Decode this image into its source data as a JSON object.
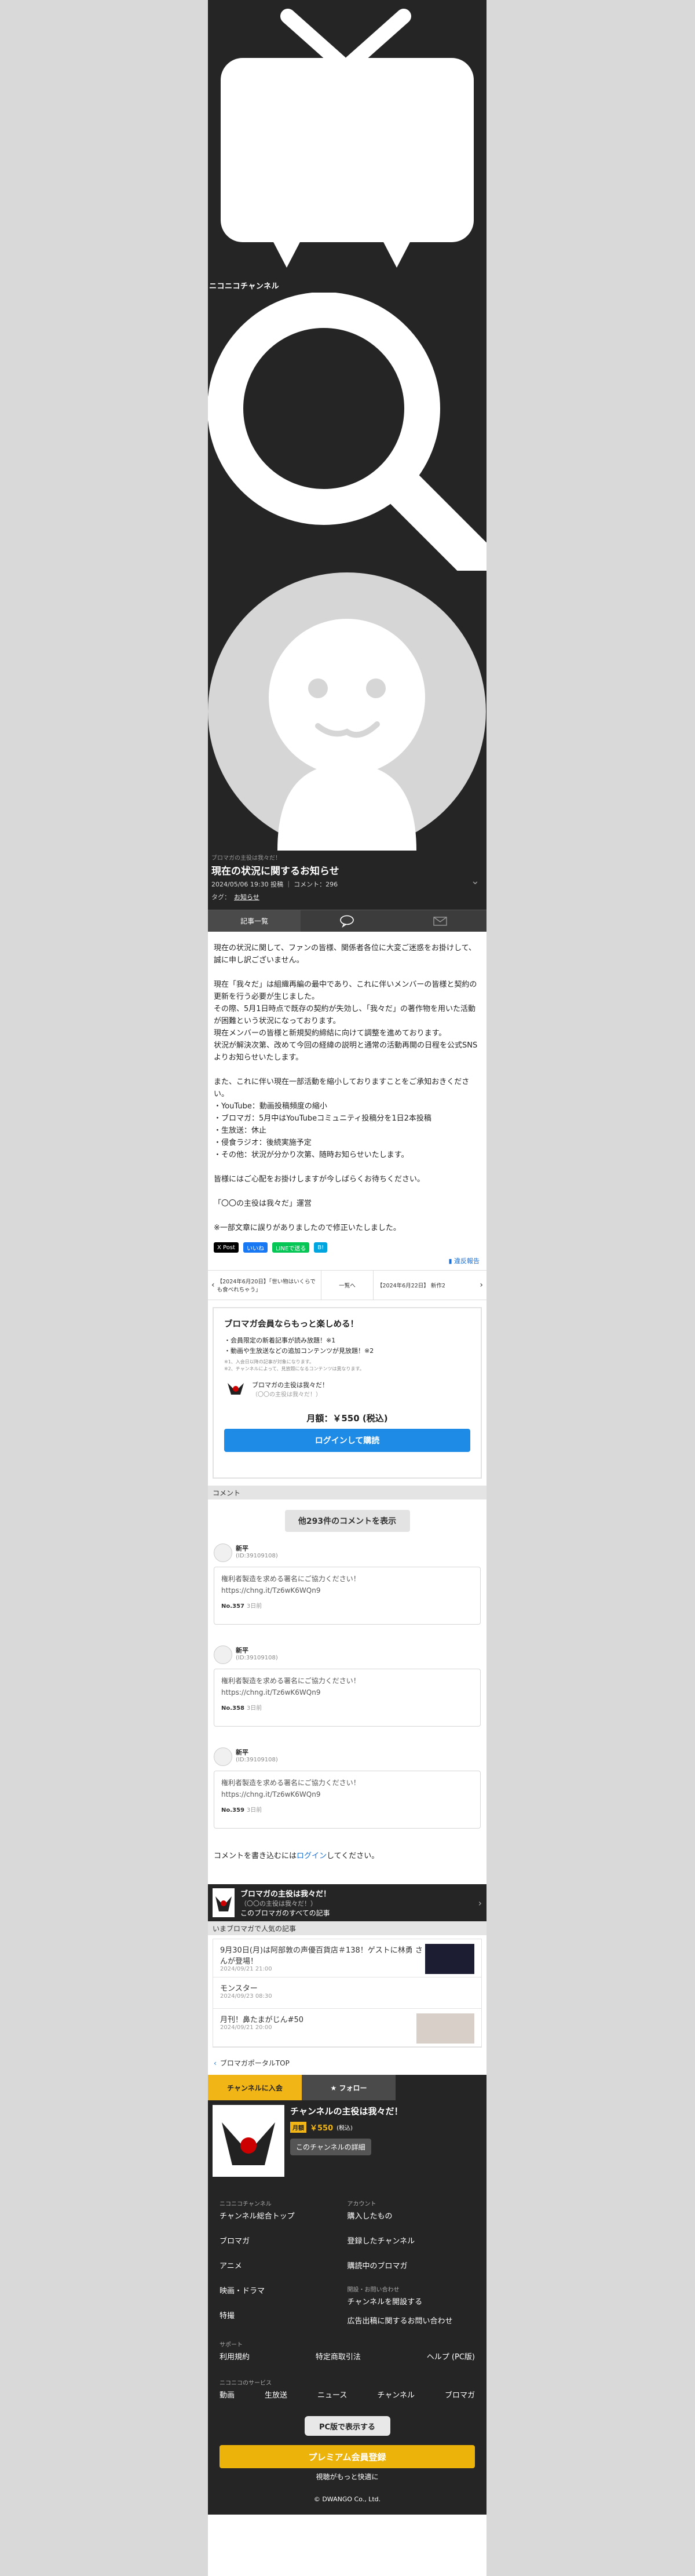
{
  "header": {
    "logo_text": "ニコニコチャンネル"
  },
  "article": {
    "category": "ブロマガの主役は我々だ！",
    "title": "現在の状況に関するお知らせ",
    "meta": "2024/05/06 19:30 投稿 ｜ コメント：296",
    "tag_label": "タグ：",
    "tag": "お知らせ",
    "paragraphs": [
      "現在の状況に関して、ファンの皆様、関係者各位に大変ご迷惑をお掛けして、誠に申し訳ございません。",
      "現在「我々だ」は組織再編の最中であり、これに伴いメンバーの皆様と契約の更新を行う必要が生じました。\nその際、5月1日時点で既存の契約が失効し、「我々だ」の著作物を用いた活動が困難という状況になっております。\n現在メンバーの皆様と新規契約締結に向けて調整を進めております。\n状況が解決次第、改めて今回の経緯の説明と通常の活動再開の日程を公式SNSよりお知らせいたします。",
      "また、これに伴い現在一部活動を縮小しておりますことをご承知おきください。\n・YouTube：動画投稿頻度の縮小\n・ブロマガ：5月中はYouTubeコミュニティ投稿分を1日2本投稿\n・生放送：休止\n・侵食ラジオ：後続実施予定\n・その他：状況が分かり次第、随時お知らせいたします。",
      "皆様にはご心配をお掛けしますが今しばらくお待ちください。",
      "「〇〇の主役は我々だ」運営",
      "※一部文章に誤りがありましたので修正いたしました。"
    ]
  },
  "tabs": [
    "記事一覧",
    "",
    ""
  ],
  "share": {
    "x": "X Post",
    "fb": "いいね",
    "line": "LINEで送る",
    "hatena": "B!"
  },
  "report": "違反報告",
  "nav": {
    "prev": "【2024年6月20日】「世い物はいくらでも食べれちゃう」",
    "list": "一覧へ",
    "next": "【2024年6月22日】 新作2"
  },
  "membership": {
    "title": "ブロマガ会員ならもっと楽しめる！",
    "items": [
      "・会員限定の新着記事が読み放題！※1",
      "・動画や生放送などの追加コンテンツが見放題！※2"
    ],
    "notes": [
      "※1、入会日以降の記事が対象になります。",
      "※2、チャンネルによって、見放題になるコンテンツは異なります。"
    ],
    "mag_name": "ブロマガの主役は我々だ！",
    "mag_sub": "（〇〇の主役は我々だ！）",
    "price": "月額：￥550 (税込)",
    "login_button": "ログインして購読"
  },
  "comments": {
    "section": "コメント",
    "more": "他293件のコメントを表示",
    "items": [
      {
        "name": "新平",
        "id": "(ID:39109108)",
        "text": "権利者製造を求める署名にご協力ください！\nhttps://chng.it/Tz6wK6WQn9",
        "no": "No.357",
        "ago": "3日前"
      },
      {
        "name": "新平",
        "id": "(ID:39109108)",
        "text": "権利者製造を求める署名にご協力ください！\nhttps://chng.it/Tz6wK6WQn9",
        "no": "No.358",
        "ago": "3日前"
      },
      {
        "name": "新平",
        "id": "(ID:39109108)",
        "text": "権利者製造を求める署名にご協力ください！\nhttps://chng.it/Tz6wK6WQn9",
        "no": "No.359",
        "ago": "3日前"
      }
    ],
    "login_pre": "コメントを書き込むには",
    "login_link": "ログイン",
    "login_post": "してください。"
  },
  "channel_bar": {
    "title": "ブロマガの主役は我々だ！",
    "sub": "（〇〇の主役は我々だ！）",
    "all": "このブロマガのすべての記事"
  },
  "popular": {
    "section": "いまブロマガで人気の記事",
    "items": [
      {
        "title": "9月30日(月)は阿部敦の声優百貨店＃138！ゲストに林勇 さんが登場！",
        "date": "2024/09/21 21:00"
      },
      {
        "title": "モンスター",
        "date": "2024/09/23 08:30"
      },
      {
        "title": "月刊！鼻たまがじん#50",
        "date": "2024/09/21 20:00"
      }
    ]
  },
  "portal": "ブロマガポータルTOP",
  "channel_info": {
    "join": "チャンネルに入会",
    "follow": "★ フォロー",
    "name": "チャンネルの主役は我々だ！",
    "badge": "月額",
    "price": "￥550",
    "tax": "(税込)",
    "detail": "このチャンネルの詳細"
  },
  "footer": {
    "col1_head": "ニコニコチャンネル",
    "col1": [
      "チャンネル総合トップ",
      "ブロマガ",
      "アニメ",
      "映画・ドラマ",
      "特撮"
    ],
    "col2_head": "アカウント",
    "col2": [
      "購入したもの",
      "登録したチャンネル",
      "購読中のブロマガ"
    ],
    "col2_head2": "開設・お問い合わせ",
    "col2b": [
      "チャンネルを開設する",
      "広告出稿に関するお問い合わせ"
    ],
    "support_head": "サポート",
    "support": [
      "利用規約",
      "特定商取引法",
      "ヘルプ (PC版)"
    ],
    "svc_head": "ニコニコのサービス",
    "svc": [
      "動画",
      "生放送",
      "ニュース",
      "チャンネル",
      "ブロマガ"
    ],
    "pc": "PC版で表示する",
    "premium": "プレミアム会員登録",
    "premium_sub": "視聴がもっと快適に",
    "copyright": "© DWANGO Co., Ltd."
  }
}
